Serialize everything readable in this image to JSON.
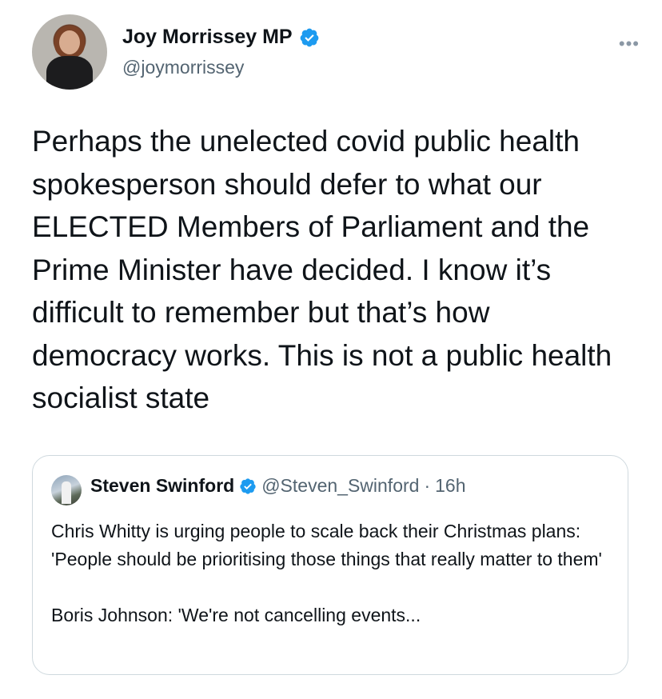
{
  "author": {
    "name": "Joy Morrissey MP",
    "handle": "@joymorrissey",
    "verified": true,
    "more_label": "•••"
  },
  "tweet": {
    "text": "Perhaps the unelected covid public health spokesperson should defer to what our ELECTED Members of Parliament and the Prime Minister have decided. I know it’s difficult to remember but that’s how democracy works. This is not a public health socialist state"
  },
  "quoted_tweet": {
    "name": "Steven Swinford",
    "handle": "@Steven_Swinford",
    "separator": "·",
    "time": "16h",
    "verified": true,
    "text_line1": "Chris Whitty is urging people to scale back their Christmas plans: 'People should be prioritising those things that really matter to them'",
    "text_line2": "Boris Johnson: 'We're not cancelling events..."
  },
  "colors": {
    "verified_blue": "#1d9bf0",
    "secondary_text": "#536471",
    "border": "#cfd9de"
  },
  "icons": {
    "verified": "verified-badge-icon",
    "more": "more-options-icon"
  }
}
